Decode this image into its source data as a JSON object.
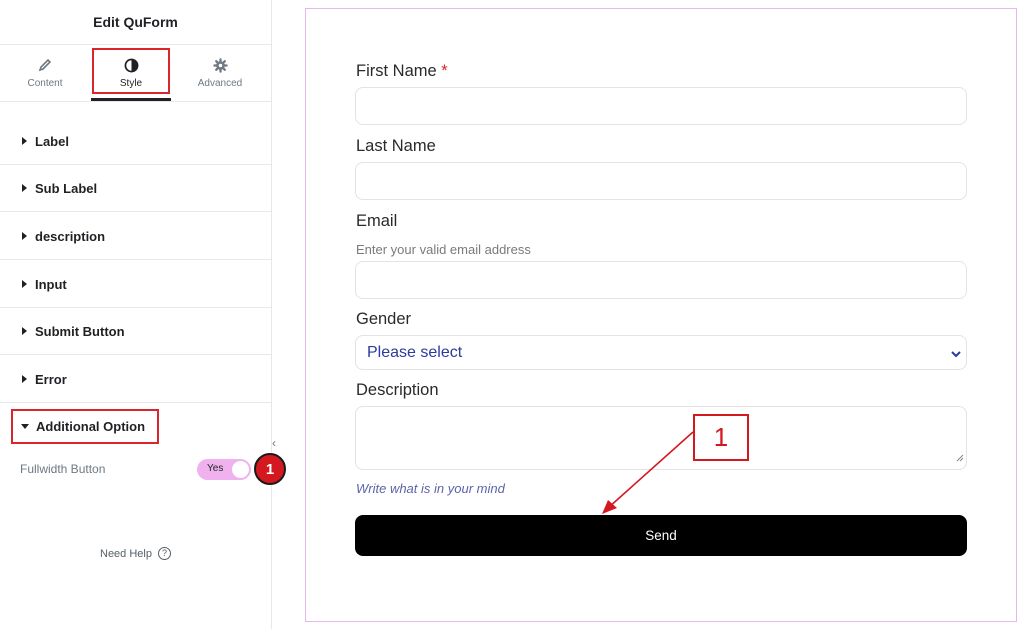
{
  "sidebar": {
    "title": "Edit QuForm",
    "tabs": [
      {
        "label": "Content",
        "icon": "pencil-icon"
      },
      {
        "label": "Style",
        "icon": "contrast-icon"
      },
      {
        "label": "Advanced",
        "icon": "gear-icon"
      }
    ],
    "active_tab": "Style",
    "sections": [
      "Label",
      "Sub Label",
      "description",
      "Input",
      "Submit Button",
      "Error",
      "Additional Option"
    ],
    "open_section": "Additional Option",
    "fullwidth_label": "Fullwidth Button",
    "fullwidth_toggle": "Yes",
    "badge": "1",
    "help": "Need Help"
  },
  "form": {
    "first_name_label": "First Name",
    "required_mark": "*",
    "last_name_label": "Last Name",
    "email_label": "Email",
    "email_help": "Enter your valid email address",
    "gender_label": "Gender",
    "gender_selected": "Please select",
    "description_label": "Description",
    "description_help": "Write what is in your mind",
    "send_label": "Send"
  },
  "annotation": {
    "callout": "1"
  },
  "colors": {
    "highlight": "#d9252c",
    "toggle": "#f0b2ee",
    "preview_border": "#e8b6ef",
    "select_text": "#2b3a9e",
    "button": "#000000"
  }
}
